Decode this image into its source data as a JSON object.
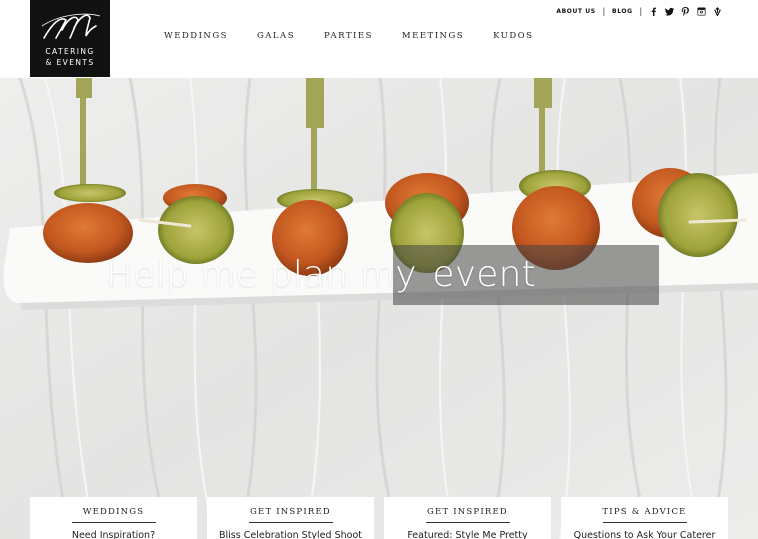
{
  "logo": {
    "line1": "CATERING",
    "line2": "& EVENTS"
  },
  "nav": [
    "WEDDINGS",
    "GALAS",
    "PARTIES",
    "MEETINGS",
    "KUDOS"
  ],
  "utility": {
    "about": "ABOUT US",
    "blog": "BLOG",
    "social": [
      "facebook-icon",
      "twitter-icon",
      "pinterest-icon",
      "instagram-icon",
      "vine-icon"
    ]
  },
  "hero": {
    "heading_main": "Help me plan my",
    "heading_event": "event"
  },
  "cards": [
    {
      "category": "WEDDINGS",
      "title": "Need Inspiration?"
    },
    {
      "category": "GET INSPIRED",
      "title": "Bliss Celebration Styled Shoot"
    },
    {
      "category": "GET INSPIRED",
      "title": "Featured: Style Me Pretty"
    },
    {
      "category": "TIPS & ADVICE",
      "title": "Questions to Ask Your Caterer"
    }
  ],
  "colors": {
    "logo_bg": "#111111",
    "overlay": "#464646",
    "text": "#222222"
  }
}
